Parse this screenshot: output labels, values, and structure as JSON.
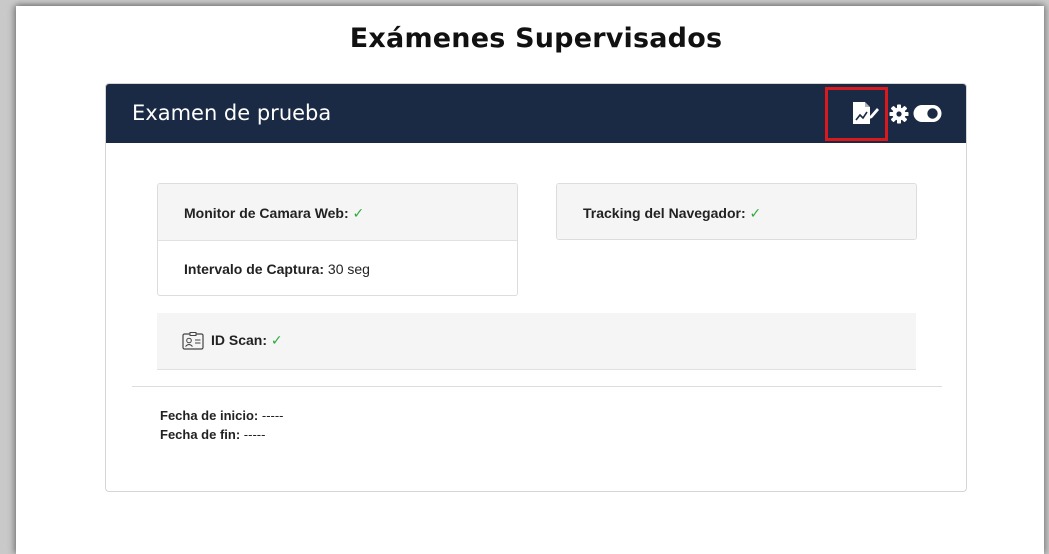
{
  "page": {
    "title": "Exámenes Supervisados"
  },
  "exam": {
    "title": "Examen de prueba",
    "header_icons": [
      "exam-report-icon",
      "gear-icon",
      "toggle-icon"
    ]
  },
  "webcam": {
    "monitor_label": "Monitor de Camara Web:",
    "monitor_status": "✓",
    "interval_label": "Intervalo de Captura:",
    "interval_value": " 30 seg"
  },
  "browser": {
    "tracking_label": "Tracking del Navegador:",
    "tracking_status": "✓"
  },
  "id_scan": {
    "label": "ID Scan:",
    "status": "✓",
    "icon": "id-card-icon"
  },
  "dates": {
    "start_label": "Fecha de inicio:",
    "start_value": " -----",
    "end_label": "Fecha de fin:",
    "end_value": " -----"
  },
  "colors": {
    "header_bg": "#1b2a44",
    "check": "#2eaa3b",
    "highlight": "#d9191e"
  }
}
